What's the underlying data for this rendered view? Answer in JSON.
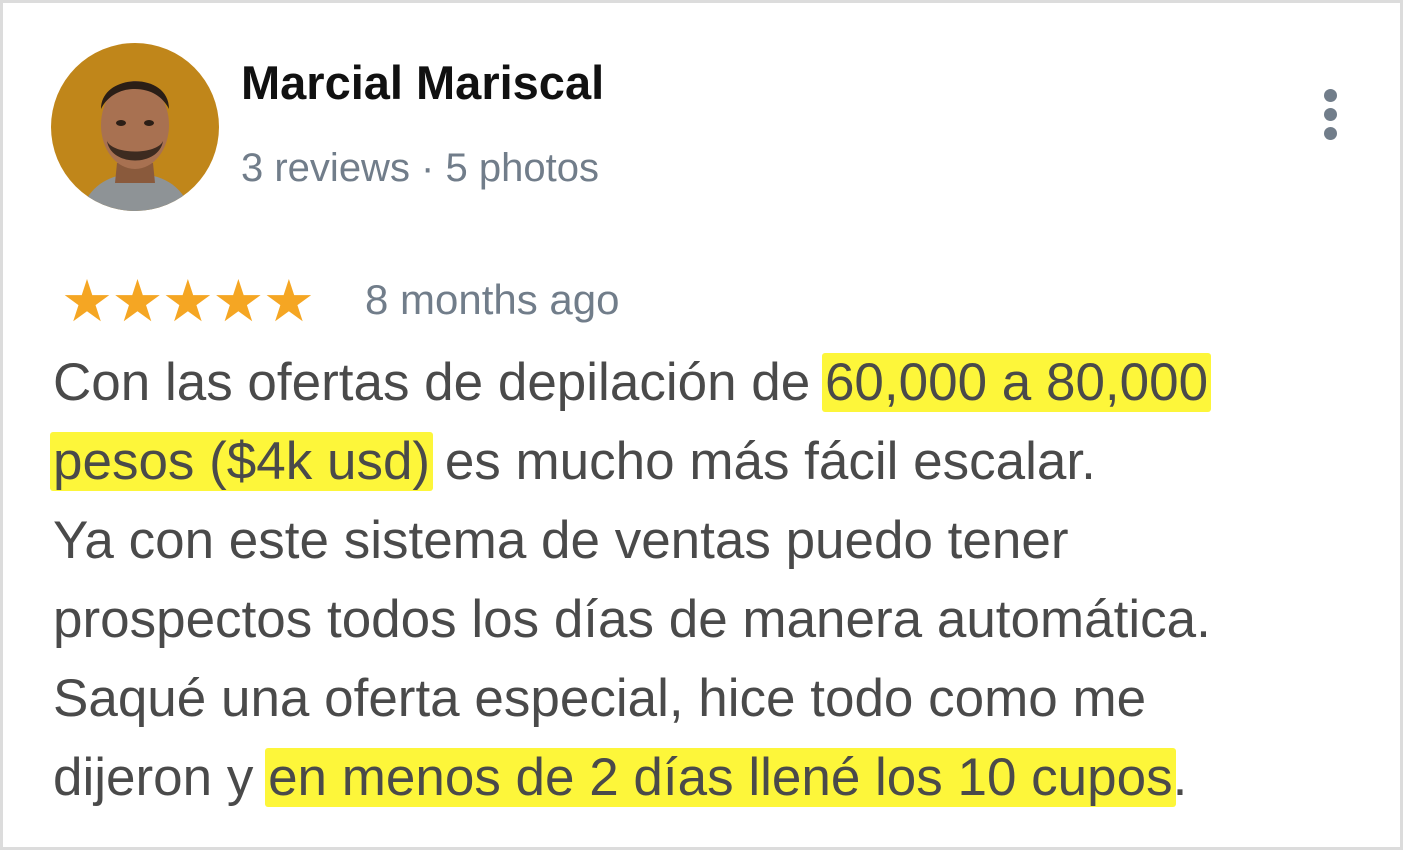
{
  "reviewer": {
    "name": "Marcial Mariscal",
    "meta": "3 reviews · 5 photos"
  },
  "rating": {
    "stars": 5,
    "star_glyph": "★",
    "time": "8 months ago"
  },
  "review": {
    "line1_a": "Con las ofertas de depilación de ",
    "line1_hl": "60,000 a 80,000",
    "line2_hl": "pesos ($4k usd)",
    "line2_b": " es mucho más fácil escalar.",
    "line3": "Ya con este sistema de ventas puedo tener",
    "line4": "prospectos todos los días de manera automática.",
    "line5": "Saqué una oferta especial, hice todo como me",
    "line6_a": "dijeron y ",
    "line6_hl": "en menos de 2 días llené los 10 cupos",
    "line6_b": "."
  },
  "colors": {
    "star": "#f5a623",
    "highlight": "#fdf63a",
    "meta_text": "#717d8a",
    "body_text": "#4a4a4a"
  },
  "icons": {
    "avatar": "avatar-photo",
    "more": "more-vertical-icon"
  }
}
